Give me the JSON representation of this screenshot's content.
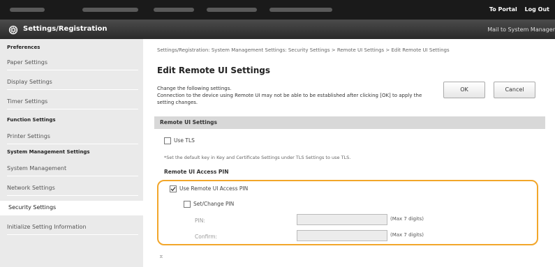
{
  "topbar": {
    "portal_link": "To Portal",
    "logout_link": "Log Out"
  },
  "header": {
    "title": "Settings/Registration",
    "mail_link": "Mail to System Manager"
  },
  "sidebar": {
    "groups": [
      {
        "heading": "Preferences",
        "items": [
          "Paper Settings",
          "Display Settings",
          "Timer Settings"
        ]
      },
      {
        "heading": "Function Settings",
        "items": [
          "Printer Settings"
        ]
      },
      {
        "heading": "System Management Settings",
        "items": [
          "System Management",
          "Network Settings",
          "Security Settings",
          "Initialize Setting Information"
        ]
      }
    ],
    "active_item": "Security Settings"
  },
  "main": {
    "breadcrumb": "Settings/Registration: System Management Settings: Security Settings > Remote UI Settings > Edit Remote UI Settings",
    "title": "Edit Remote UI Settings",
    "instruction_line1": "Change the following settings.",
    "instruction_line2": "Connection to the device using Remote UI may not be able to be established after clicking [OK] to apply the setting changes.",
    "ok_button": "OK",
    "cancel_button": "Cancel",
    "section_title": "Remote UI Settings",
    "use_tls_label": "Use TLS",
    "use_tls_checked": false,
    "tls_note": "*Set the default key in Key and Certificate Settings under TLS Settings to use TLS.",
    "pin_heading": "Remote UI Access PIN",
    "use_pin_label": "Use Remote UI Access PIN",
    "use_pin_checked": true,
    "set_change_pin_label": "Set/Change PIN",
    "set_change_pin_checked": false,
    "pin_label": "PIN:",
    "pin_note": "(Max 7 digits)",
    "confirm_label": "Confirm:",
    "confirm_note": "(Max 7 digits)",
    "highlight_color": "#f2a62a",
    "scroll_marker": "⌅"
  }
}
